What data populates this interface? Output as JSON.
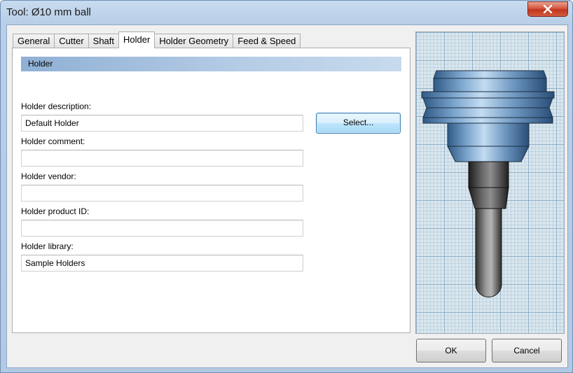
{
  "window": {
    "title": "Tool: Ø10 mm ball",
    "close_symbol": "✕"
  },
  "tabs": [
    {
      "label": "General",
      "active": false
    },
    {
      "label": "Cutter",
      "active": false
    },
    {
      "label": "Shaft",
      "active": false
    },
    {
      "label": "Holder",
      "active": true
    },
    {
      "label": "Holder Geometry",
      "active": false
    },
    {
      "label": "Feed & Speed",
      "active": false
    }
  ],
  "holder": {
    "section_title": "Holder",
    "description_label": "Holder description:",
    "description_value": "Default Holder",
    "select_button": "Select...",
    "comment_label": "Holder comment:",
    "comment_value": "",
    "vendor_label": "Holder vendor:",
    "vendor_value": "",
    "product_id_label": "Holder product ID:",
    "product_id_value": "",
    "library_label": "Holder library:",
    "library_value": "Sample Holders"
  },
  "buttons": {
    "ok": "OK",
    "cancel": "Cancel"
  },
  "colors": {
    "holder_blue": "#5b86b3",
    "shaft_dark": "#3a3a3a",
    "grid_bg": "#d9e6ee"
  }
}
